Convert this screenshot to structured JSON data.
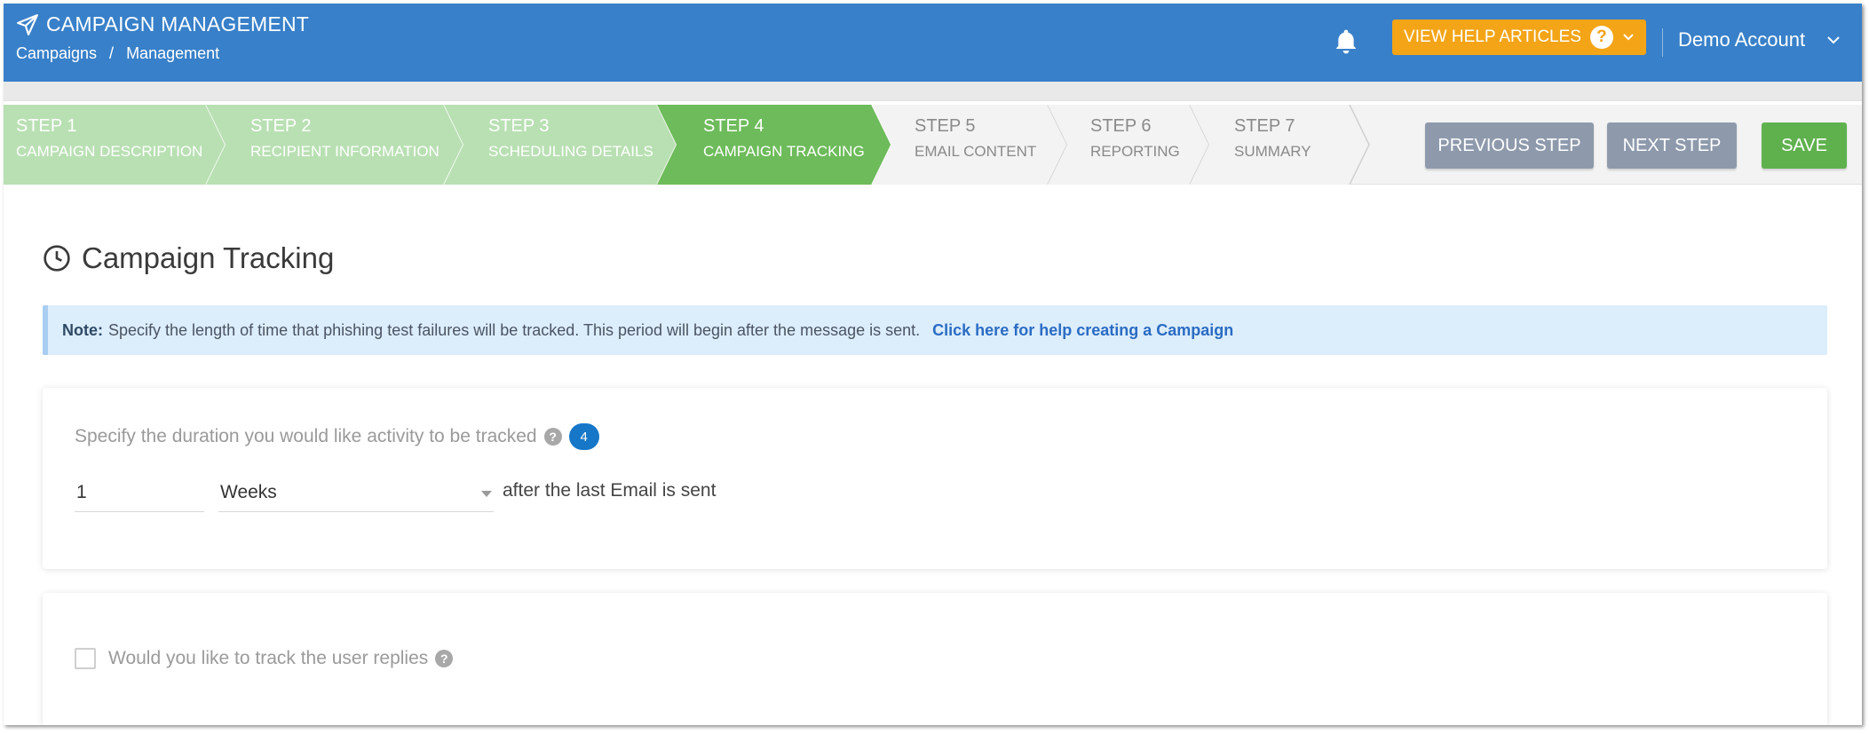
{
  "header": {
    "title": "CAMPAIGN MANAGEMENT",
    "breadcrumb": [
      "Campaigns",
      "/",
      "Management"
    ],
    "help_label": "VIEW HELP ARTICLES",
    "help_icon": "?",
    "account": "Demo Account",
    "bar_color": "#3880c9",
    "help_color": "#f4a417"
  },
  "steps": [
    {
      "number": "STEP 1",
      "name": "CAMPAIGN DESCRIPTION",
      "status": "done"
    },
    {
      "number": "STEP 2",
      "name": "RECIPIENT INFORMATION",
      "status": "done"
    },
    {
      "number": "STEP 3",
      "name": "SCHEDULING DETAILS",
      "status": "done"
    },
    {
      "number": "STEP 4",
      "name": "CAMPAIGN TRACKING",
      "status": "active"
    },
    {
      "number": "STEP 5",
      "name": "EMAIL CONTENT",
      "status": "todo"
    },
    {
      "number": "STEP 6",
      "name": "REPORTING",
      "status": "todo"
    },
    {
      "number": "STEP 7",
      "name": "SUMMARY",
      "status": "todo"
    }
  ],
  "step_colors": {
    "done": "#b9e0b3",
    "active": "#6dbb5a",
    "todo": "#f3f3f3"
  },
  "actions": {
    "previous": "PREVIOUS STEP",
    "next": "NEXT STEP",
    "save": "SAVE"
  },
  "section": {
    "title": "Campaign Tracking"
  },
  "note": {
    "label": "Note:",
    "text": "Specify the length of time that phishing test failures will be tracked. This period will begin after the message is sent.",
    "link": "Click here for help creating a Campaign"
  },
  "tracking": {
    "question": "Specify the duration you would like activity to be tracked",
    "help_icon": "?",
    "badge": "4",
    "duration_value": "1",
    "unit_selected": "Weeks",
    "suffix": "after the last Email is sent"
  },
  "replies": {
    "question": "Would you like to track the user replies",
    "help_icon": "?",
    "checked": false
  }
}
